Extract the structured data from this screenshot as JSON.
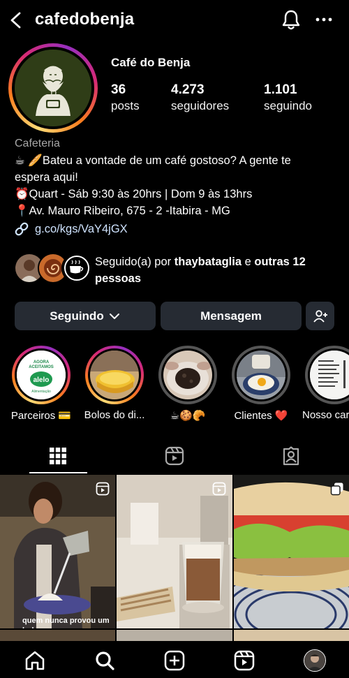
{
  "header": {
    "username": "cafedobenja"
  },
  "profile": {
    "display_name": "Café do Benja",
    "stats": [
      {
        "value": "36",
        "label": "posts"
      },
      {
        "value": "4.273",
        "label": "seguidores"
      },
      {
        "value": "1.101",
        "label": "seguindo"
      }
    ],
    "category": "Cafeteria",
    "bio": [
      "☕ 🥖Bateu a vontade de um café gostoso? A gente te",
      "espera aqui!",
      "⏰Quart - Sáb 9:30 às 20hrs | Dom 9 às 13hrs",
      "📍Av. Mauro Ribeiro, 675 - 2 -Itabira - MG"
    ],
    "link": "g.co/kgs/VaY4jGX"
  },
  "followed_by": {
    "prefix": "Seguido(a) por ",
    "user": "thaybataglia",
    "middle": " e ",
    "others": "outras 12 pessoas"
  },
  "actions": {
    "following_label": "Seguindo",
    "message_label": "Mensagem"
  },
  "highlights": [
    {
      "label": "Parceiros 💳",
      "ring": "grad",
      "badge_top": "AGORA",
      "badge_mid": "ACEITAMOS",
      "badge_brand": "alelo",
      "badge_sub": "Alimentação"
    },
    {
      "label": "Bolos do di...",
      "ring": "grad"
    },
    {
      "label": "☕🍪🥐",
      "ring": "gray"
    },
    {
      "label": "Clientes ❤️",
      "ring": "gray"
    },
    {
      "label": "Nosso car",
      "ring": "gray"
    }
  ],
  "posts": [
    {
      "caption": "quem nunca provou um bolo que",
      "type": "reel"
    },
    {
      "type": "reel"
    },
    {
      "type": "carousel"
    }
  ],
  "colors": {
    "background": "#000000",
    "button": "#262b33",
    "link": "#cfe3ff",
    "muted": "#a8a8a8"
  },
  "icons": [
    "back-arrow-icon",
    "bell-icon",
    "more-dots-icon",
    "link-icon",
    "chevron-down-icon",
    "add-person-icon",
    "grid-icon",
    "reels-icon",
    "tagged-icon",
    "home-icon",
    "search-icon",
    "create-icon",
    "reels-nav-icon",
    "profile-avatar"
  ]
}
